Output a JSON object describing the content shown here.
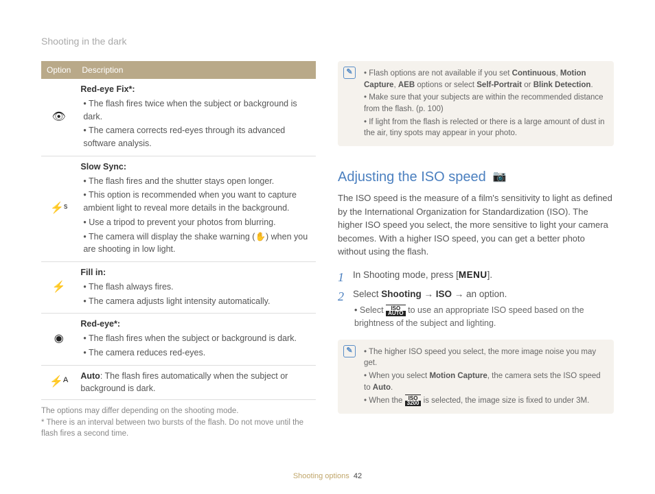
{
  "breadcrumb": "Shooting in the dark",
  "table": {
    "head_option": "Option",
    "head_desc": "Description",
    "rows": [
      {
        "icon": "👁",
        "name": "Red-eye Fix*:",
        "bullets": [
          "The flash fires twice when the subject or background is dark.",
          "The camera corrects red-eyes through its advanced software analysis."
        ]
      },
      {
        "icon": "⚡ˢ",
        "name": "Slow Sync:",
        "bullets": [
          "The flash fires and the shutter stays open longer.",
          "This option is recommended when you want to capture ambient light to reveal more details in the background.",
          "Use a tripod to prevent your photos from blurring.",
          "The camera will display the shake warning (✋) when you are shooting in low light."
        ]
      },
      {
        "icon": "⚡",
        "name": "Fill in:",
        "bullets": [
          "The flash always fires.",
          "The camera adjusts light intensity automatically."
        ]
      },
      {
        "icon": "◉",
        "name": "Red-eye*:",
        "bullets": [
          "The flash fires when the subject or background is dark.",
          "The camera reduces red-eyes."
        ]
      },
      {
        "icon": "⚡ᴬ",
        "name": "Auto",
        "inline_desc": ": The flash fires automatically when the subject or background is dark."
      }
    ]
  },
  "footnote_1": "The options may differ depending on the shooting mode.",
  "footnote_2": "* There is an interval between two bursts of the flash. Do not move until the flash fires a second time.",
  "note_top": {
    "b1_a": "Flash options are not available if you set ",
    "b1_b": "Continuous",
    "b1_c": ", ",
    "b1_d": "Motion Capture",
    "b1_e": ", ",
    "b1_f": "AEB",
    "b1_g": " options or select ",
    "b1_h": "Self-Portrait",
    "b1_i": " or ",
    "b1_j": "Blink Detection",
    "b1_k": ".",
    "b2": "Make sure that your subjects are within the recommended distance from the flash. (p. 100)",
    "b3": "If light from the flash is relected or there is a large amount of dust in the air, tiny spots may appear in your photo."
  },
  "section_title": "Adjusting the ISO speed",
  "intro": "The ISO speed is the measure of a film's sensitivity to light as defined by the International Organization for Standardization (ISO). The higher ISO speed you select, the more sensitive to light your camera becomes. With a higher ISO speed, you can get a better photo without using the flash.",
  "steps": {
    "s1_a": "In Shooting mode, press [",
    "s1_b": "MENU",
    "s1_c": "].",
    "s2_a": "Select ",
    "s2_b": "Shooting",
    "s2_c": " → ",
    "s2_d": "ISO",
    "s2_e": " → an option.",
    "s2_sub_a": "Select ",
    "s2_sub_b": " to use an appropriate ISO speed based on the brightness of the subject and lighting."
  },
  "iso_auto_top": "ISO",
  "iso_auto_bot": "AUTO",
  "iso_3200_top": "ISO",
  "iso_3200_bot": "3200",
  "note_bottom": {
    "b1": "The higher ISO speed you select, the more image noise you may get.",
    "b2_a": "When you select ",
    "b2_b": "Motion Capture",
    "b2_c": ", the camera sets the ISO speed to ",
    "b2_d": "Auto",
    "b2_e": ".",
    "b3_a": "When the ",
    "b3_b": " is selected, the image size is fixed to under 3M."
  },
  "footer_label": "Shooting options",
  "footer_page": "42"
}
